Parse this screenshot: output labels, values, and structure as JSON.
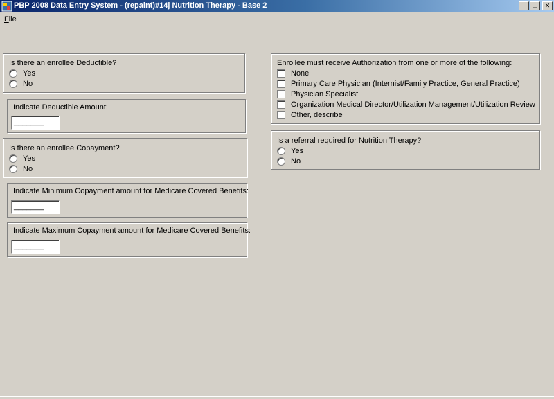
{
  "window": {
    "title": "PBP 2008 Data Entry System - (repaint)#14j Nutrition Therapy - Base 2",
    "minimize_glyph": "_",
    "restore_glyph": "❐",
    "close_glyph": "✕"
  },
  "menu": {
    "file_accel": "F",
    "file_rest": "ile"
  },
  "left": {
    "deductible": {
      "question": "Is there an enrollee Deductible?",
      "yes": "Yes",
      "no": "No"
    },
    "deductible_amount": {
      "label": "Indicate Deductible Amount:",
      "value": "_______"
    },
    "copayment": {
      "question": "Is there an enrollee Copayment?",
      "yes": "Yes",
      "no": "No"
    },
    "min_copay": {
      "label": "Indicate Minimum Copayment amount for Medicare Covered Benefits:",
      "value": "_______"
    },
    "max_copay": {
      "label": "Indicate Maximum Copayment amount for Medicare Covered Benefits:",
      "value": "_______"
    }
  },
  "right": {
    "authorization": {
      "question": "Enrollee must receive Authorization from one or more of the following:",
      "options": [
        "None",
        "Primary Care Physician (Internist/Family Practice, General Practice)",
        "Physician Specialist",
        "Organization Medical Director/Utilization Management/Utilization Review",
        "Other, describe"
      ]
    },
    "referral": {
      "question": "Is a referral required for Nutrition Therapy?",
      "yes": "Yes",
      "no": "No"
    }
  }
}
